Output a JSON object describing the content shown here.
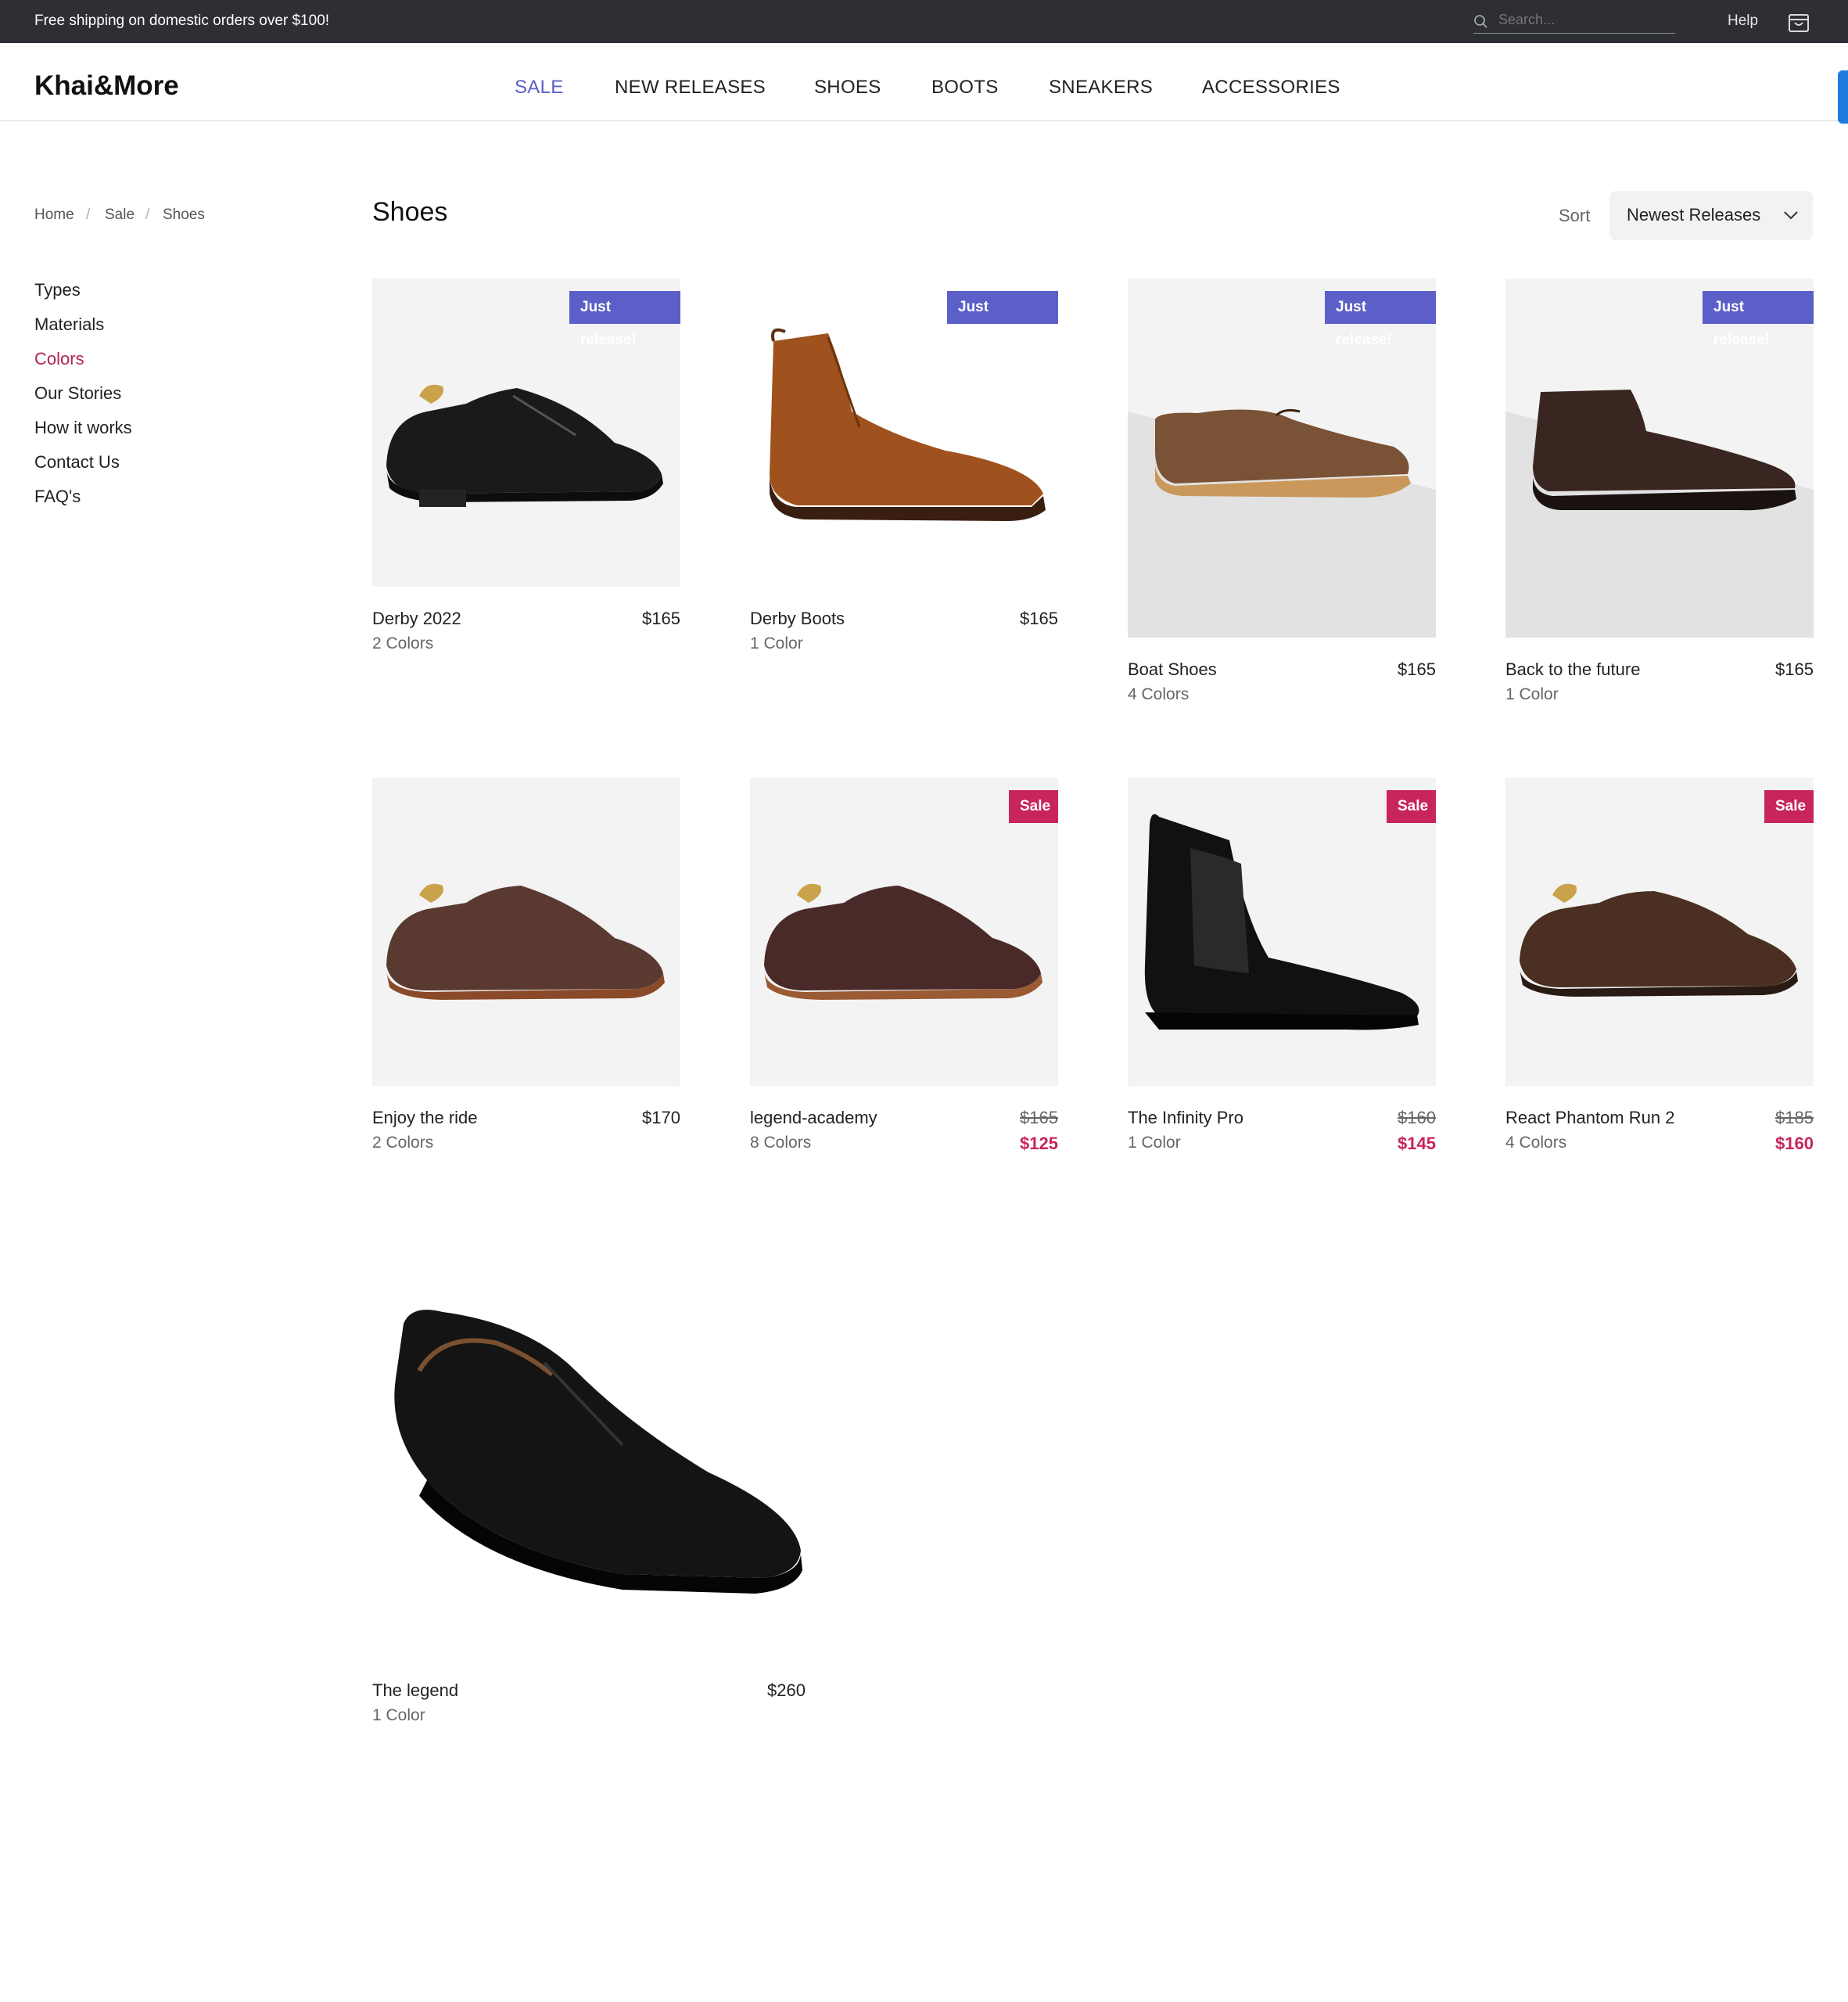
{
  "topbar": {
    "shipping_text": "Free shipping on domestic orders over $100!",
    "search_placeholder": "Search...",
    "help_label": "Help",
    "cart_icon": "shopping-bag-icon"
  },
  "header": {
    "logo": "Khai&More",
    "nav": [
      "SALE",
      "NEW RELEASES",
      "SHOES",
      "BOOTS",
      "SNEAKERS",
      "ACCESSORIES"
    ],
    "active_nav": "SALE"
  },
  "breadcrumb": [
    "Home",
    "Sale",
    "Shoes"
  ],
  "sidebar": {
    "links": [
      "Types",
      "Materials",
      "Colors",
      "Our Stories",
      "How it works",
      "Contact Us",
      "FAQ's"
    ],
    "active": "Colors"
  },
  "main": {
    "title": "Shoes",
    "sort_label": "Sort",
    "sort_value": "Newest Releases"
  },
  "colors": {
    "accent": "#5b5fc7",
    "sale": "#c8255a",
    "topbar_bg": "#2d2f35"
  },
  "products": [
    {
      "name": "Derby 2022",
      "colors": "2 Colors",
      "price": "$165",
      "badge": "Just release!"
    },
    {
      "name": "Derby Boots",
      "colors": "1 Color",
      "price": "$165",
      "badge": "Just release!"
    },
    {
      "name": "Boat Shoes",
      "colors": "4 Colors",
      "price": "$165",
      "badge": "Just release!"
    },
    {
      "name": "Back to the future",
      "colors": "1 Color",
      "price": "$165",
      "badge": "Just release!"
    },
    {
      "name": "Enjoy the ride",
      "colors": "2 Colors",
      "price": "$170",
      "badge": ""
    },
    {
      "name": "legend-academy",
      "colors": "8 Colors",
      "old_price": "$165",
      "price": "$125",
      "badge": "Sale"
    },
    {
      "name": "The Infinity Pro",
      "colors": "1 Color",
      "old_price": "$160",
      "price": "$145",
      "badge": "Sale"
    },
    {
      "name": "React Phantom Run 2",
      "colors": "4 Colors",
      "old_price": "$185",
      "price": "$160",
      "badge": "Sale"
    },
    {
      "name": "The legend",
      "colors": "1 Color",
      "price": "$260",
      "badge": ""
    }
  ]
}
